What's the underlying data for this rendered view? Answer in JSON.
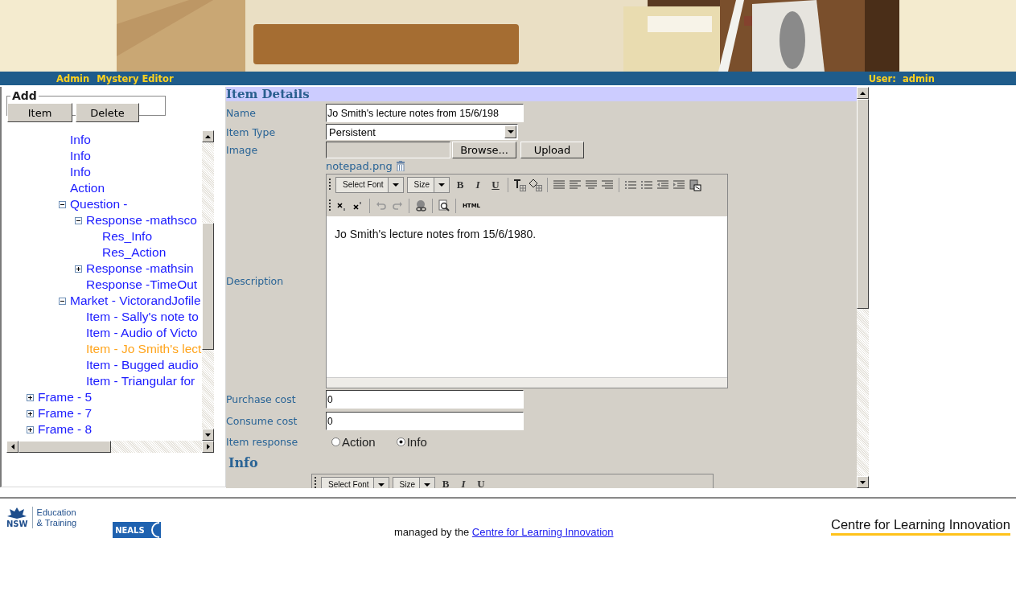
{
  "header": {
    "nav": [
      "Admin",
      "Mystery Editor"
    ],
    "user_label": "User:",
    "user_name": "admin"
  },
  "add_panel": {
    "legend": "Add",
    "buttons": [
      "Item",
      "Delete"
    ]
  },
  "tree": [
    {
      "children": [
        {
          "children": [
            {
              "label": "Info",
              "selected": false
            },
            {
              "label": "Info",
              "selected": false
            },
            {
              "label": "Info",
              "selected": false
            },
            {
              "label": "Action",
              "selected": false
            },
            {
              "label": "Question -",
              "expanded": true,
              "selected": false,
              "children": [
                {
                  "label": "Response -mathsco",
                  "expanded": true,
                  "selected": false,
                  "children": [
                    {
                      "label": "Res_Info",
                      "selected": false
                    },
                    {
                      "label": "Res_Action",
                      "selected": false
                    }
                  ]
                },
                {
                  "label": "Response -mathsin",
                  "expanded": false,
                  "selected": false
                },
                {
                  "label": "Response -TimeOut",
                  "selected": false
                }
              ]
            },
            {
              "label": "Market - VictorandJofile",
              "expanded": true,
              "selected": false,
              "children": [
                {
                  "label": "Item - Sally's note to",
                  "selected": false
                },
                {
                  "label": "Item - Audio of Victo",
                  "selected": false
                },
                {
                  "label": "Item - Jo Smith's lect",
                  "selected": true
                },
                {
                  "label": "Item - Bugged audio",
                  "selected": false
                },
                {
                  "label": "Item - Triangular for",
                  "selected": false
                }
              ]
            }
          ]
        }
      ]
    },
    {
      "label": "Frame - 5",
      "expanded": false,
      "selected": false
    },
    {
      "label": "Frame - 7",
      "expanded": false,
      "selected": false
    },
    {
      "label": "Frame - 8",
      "expanded": false,
      "selected": false
    }
  ],
  "form": {
    "title": "Item Details",
    "fields": [
      {
        "kind": "text",
        "label": "Name",
        "value": "Jo Smith's lecture notes from 15/6/198"
      },
      {
        "kind": "select",
        "label": "Item Type",
        "value": "Persistent"
      },
      {
        "kind": "file",
        "label": "Image",
        "buttons": [
          "Browse...",
          "Upload"
        ],
        "file_link": "notepad.png"
      },
      {
        "kind": "editor",
        "label": "Description",
        "toolbar": {
          "font": "Select Font",
          "size": "Size",
          "bold": "B",
          "italic": "I",
          "underline": "U",
          "html": "HTML"
        },
        "content": "Jo Smith's lecture notes from 15/6/1980."
      },
      {
        "kind": "text",
        "label": "Purchase cost",
        "value": "0"
      },
      {
        "kind": "text",
        "label": "Consume cost",
        "value": "0"
      },
      {
        "kind": "radio",
        "label": "Item response",
        "options": [
          {
            "label": "Action",
            "selected": false
          },
          {
            "label": "Info",
            "selected": true
          }
        ]
      }
    ]
  },
  "info_section": {
    "title": "Info",
    "toolbar": {
      "font": "Select Font",
      "size": "Size",
      "bold": "B",
      "italic": "I",
      "underline": "U"
    }
  },
  "footer": {
    "nsw": "NSW",
    "dept": [
      "Education",
      "& Training"
    ],
    "neals": "NEALS",
    "text": "managed by the",
    "link": "Centre for Learning Innovation",
    "cli_logo": "Centre for Learning Innovation"
  }
}
